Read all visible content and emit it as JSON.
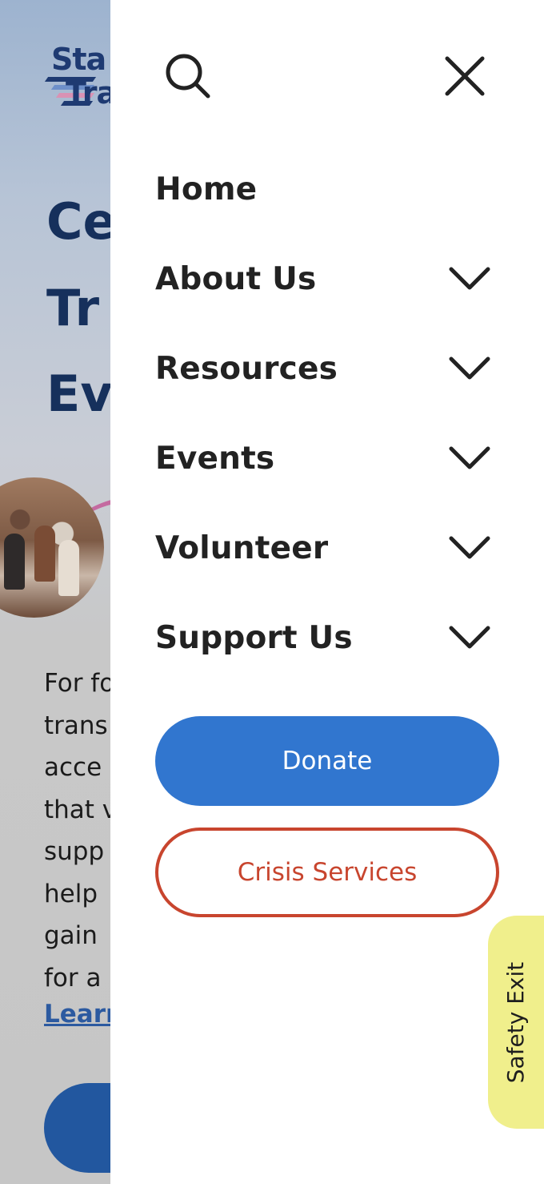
{
  "background_page": {
    "logo": {
      "line1": "Sta",
      "line2": "Tra"
    },
    "hero_title": [
      "Ce",
      "Tr",
      "Ev"
    ],
    "body_lines": [
      "For fo",
      "trans",
      "acce",
      "that v",
      "supp",
      "help",
      "gain",
      "for a"
    ],
    "learn_more_partial": "Learn"
  },
  "drawer": {
    "search_icon": "search-icon",
    "close_icon": "close-icon",
    "nav": [
      {
        "label": "Home",
        "has_submenu": false
      },
      {
        "label": "About Us",
        "has_submenu": true
      },
      {
        "label": "Resources",
        "has_submenu": true
      },
      {
        "label": "Events",
        "has_submenu": true
      },
      {
        "label": "Volunteer",
        "has_submenu": true
      },
      {
        "label": "Support Us",
        "has_submenu": true
      }
    ],
    "donate_label": "Donate",
    "crisis_label": "Crisis Services"
  },
  "safety_exit": {
    "label": "Safety Exit"
  },
  "colors": {
    "donate_bg": "#3176cf",
    "crisis_border": "#c8452e",
    "safety_bg": "#f0ef8c",
    "nav_text": "#222222"
  }
}
